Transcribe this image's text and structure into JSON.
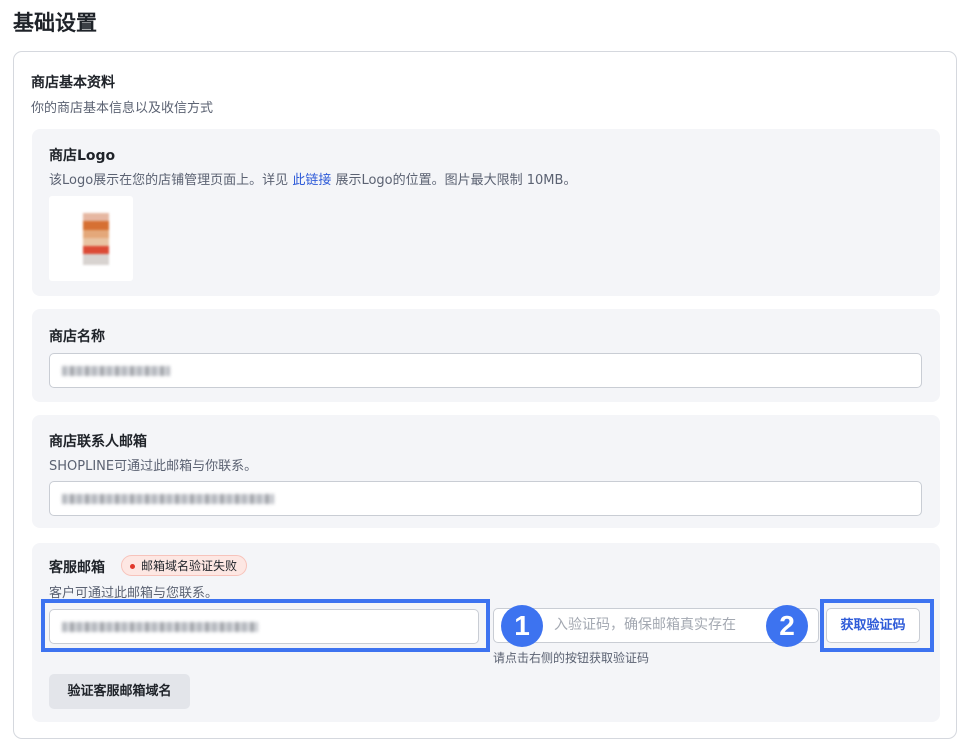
{
  "page_title": "基础设置",
  "card": {
    "title": "商店基本资料",
    "subtitle": "你的商店基本信息以及收信方式"
  },
  "logo_section": {
    "title": "商店Logo",
    "desc_before": "该Logo展示在您的店铺管理页面上。详见 ",
    "desc_link": "此链接",
    "desc_after": " 展示Logo的位置。图片最大限制 10MB。"
  },
  "store_name": {
    "title": "商店名称"
  },
  "contact_email": {
    "title": "商店联系人邮箱",
    "desc": "SHOPLINE可通过此邮箱与你联系。"
  },
  "service_email": {
    "title": "客服邮箱",
    "badge": "邮箱域名验证失败",
    "desc": "客户可通过此邮箱与您联系。",
    "code_placeholder": "入验证码，确保邮箱真实存在",
    "hint": "请点击右侧的按钮获取验证码",
    "code_button": "获取验证码",
    "verify_button": "验证客服邮箱域名"
  },
  "annotations": {
    "step1": "1",
    "step2": "2",
    "highlight_color": "#3d73f0"
  },
  "colors": {
    "link": "#2e5bd8",
    "error_dot": "#e1382c"
  }
}
